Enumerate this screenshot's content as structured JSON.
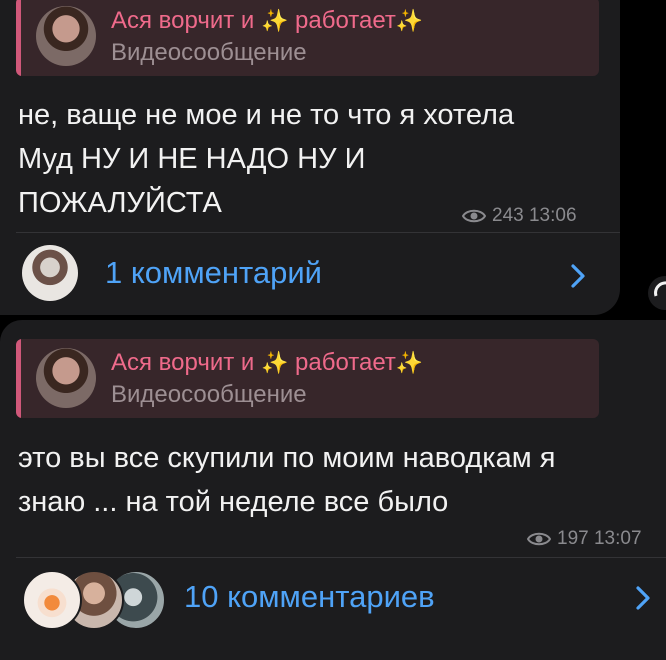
{
  "messages": [
    {
      "reply": {
        "name_prefix": "Ася ворчит и ",
        "name_sparkle_1": "✨",
        "name_mid": " работает",
        "name_sparkle_2": "✨",
        "subtitle": "Видеосообщение"
      },
      "text_lines": [
        "не, ваще не мое и не то что я хотела",
        "Муд НУ И НЕ НАДО НУ И",
        "ПОЖАЛУЙСТА"
      ],
      "views": "243",
      "time": "13:06",
      "comments_label": "1 комментарий"
    },
    {
      "reply": {
        "name_prefix": "Ася ворчит и ",
        "name_sparkle_1": "✨",
        "name_mid": " работает",
        "name_sparkle_2": "✨",
        "subtitle": "Видеосообщение"
      },
      "text_lines": [
        "это вы все скупили по моим наводкам я",
        "знаю ... на той неделе все было"
      ],
      "views": "197",
      "time": "13:07",
      "comments_label": "10 комментариев"
    }
  ],
  "icons": {
    "views": "eye-icon",
    "open_comments": "chevron-right-icon",
    "reply_thumbnail": "video-message-thumbnail"
  },
  "colors": {
    "bubble_bg": "#1c1c1e",
    "reply_bg": "#37262a",
    "reply_accent": "#d0587a",
    "reply_name": "#ef6a8b",
    "link": "#4fa3f7",
    "meta": "#8a8a8e"
  }
}
